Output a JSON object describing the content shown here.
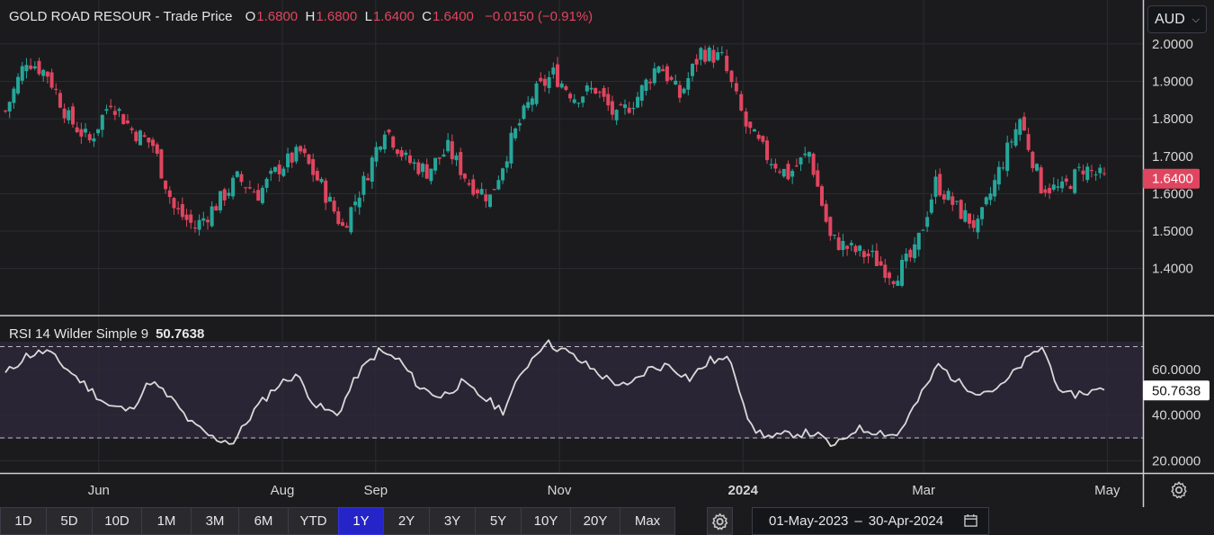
{
  "header": {
    "symbol": "GOLD ROAD RESOUR",
    "separator": "-",
    "price_type": "Trade Price",
    "open_label": "O",
    "open": "1.6800",
    "high_label": "H",
    "high": "1.6800",
    "low_label": "L",
    "low": "1.6400",
    "close_label": "C",
    "close": "1.6400",
    "change": "−0.0150 (−0.91%)"
  },
  "currency_select": {
    "value": "AUD",
    "icon": "chevron-down-icon"
  },
  "rsi_legend": {
    "label": "RSI 14 Wilder Simple 9",
    "value": "50.7638"
  },
  "range_buttons": [
    "1D",
    "5D",
    "10D",
    "1M",
    "3M",
    "6M",
    "YTD",
    "1Y",
    "2Y",
    "3Y",
    "5Y",
    "10Y",
    "20Y",
    "Max"
  ],
  "active_range": "1Y",
  "date_range": {
    "start": "01-May-2023",
    "separator": "–",
    "end": "30-Apr-2024",
    "icon": "calendar-icon"
  },
  "colors": {
    "up": "#26a69a",
    "down": "#e0455f",
    "rsi_line": "#d9d9d9",
    "rsi_band": "#2a2535",
    "active_button": "#2424c8"
  },
  "chart_data": [
    {
      "type": "candlestick",
      "title": "GOLD ROAD RESOUR - Trade Price",
      "ylim": [
        1.32,
        2.05
      ],
      "y_ticks": [
        "2.0000",
        "1.9000",
        "1.8000",
        "1.7000",
        "1.6000",
        "1.5000",
        "1.4000"
      ],
      "x_ticks": [
        "Jun",
        "Aug",
        "Sep",
        "Nov",
        "2024",
        "Mar",
        "May"
      ],
      "last_price_label": "1.6400",
      "grid": true,
      "close_series": [
        {
          "date": "2023-05-01",
          "close": 1.82
        },
        {
          "date": "2023-05-08",
          "close": 1.96
        },
        {
          "date": "2023-05-15",
          "close": 1.92
        },
        {
          "date": "2023-05-22",
          "close": 1.8
        },
        {
          "date": "2023-05-29",
          "close": 1.74
        },
        {
          "date": "2023-06-05",
          "close": 1.85
        },
        {
          "date": "2023-06-12",
          "close": 1.77
        },
        {
          "date": "2023-06-19",
          "close": 1.73
        },
        {
          "date": "2023-06-26",
          "close": 1.56
        },
        {
          "date": "2023-07-03",
          "close": 1.51
        },
        {
          "date": "2023-07-10",
          "close": 1.57
        },
        {
          "date": "2023-07-17",
          "close": 1.64
        },
        {
          "date": "2023-07-24",
          "close": 1.6
        },
        {
          "date": "2023-07-31",
          "close": 1.67
        },
        {
          "date": "2023-08-07",
          "close": 1.71
        },
        {
          "date": "2023-08-14",
          "close": 1.62
        },
        {
          "date": "2023-08-21",
          "close": 1.51
        },
        {
          "date": "2023-08-28",
          "close": 1.63
        },
        {
          "date": "2023-09-04",
          "close": 1.78
        },
        {
          "date": "2023-09-11",
          "close": 1.69
        },
        {
          "date": "2023-09-18",
          "close": 1.66
        },
        {
          "date": "2023-09-25",
          "close": 1.72
        },
        {
          "date": "2023-10-02",
          "close": 1.63
        },
        {
          "date": "2023-10-09",
          "close": 1.59
        },
        {
          "date": "2023-10-16",
          "close": 1.74
        },
        {
          "date": "2023-10-23",
          "close": 1.86
        },
        {
          "date": "2023-10-30",
          "close": 1.92
        },
        {
          "date": "2023-11-06",
          "close": 1.86
        },
        {
          "date": "2023-11-13",
          "close": 1.88
        },
        {
          "date": "2023-11-20",
          "close": 1.8
        },
        {
          "date": "2023-11-27",
          "close": 1.86
        },
        {
          "date": "2023-12-04",
          "close": 1.95
        },
        {
          "date": "2023-12-11",
          "close": 1.86
        },
        {
          "date": "2023-12-18",
          "close": 1.98
        },
        {
          "date": "2023-12-25",
          "close": 1.96
        },
        {
          "date": "2024-01-02",
          "close": 1.78
        },
        {
          "date": "2024-01-09",
          "close": 1.7
        },
        {
          "date": "2024-01-16",
          "close": 1.65
        },
        {
          "date": "2024-01-23",
          "close": 1.71
        },
        {
          "date": "2024-01-30",
          "close": 1.48
        },
        {
          "date": "2024-02-06",
          "close": 1.45
        },
        {
          "date": "2024-02-13",
          "close": 1.43
        },
        {
          "date": "2024-02-20",
          "close": 1.38
        },
        {
          "date": "2024-02-27",
          "close": 1.44
        },
        {
          "date": "2024-03-05",
          "close": 1.63
        },
        {
          "date": "2024-03-12",
          "close": 1.56
        },
        {
          "date": "2024-03-19",
          "close": 1.51
        },
        {
          "date": "2024-03-26",
          "close": 1.66
        },
        {
          "date": "2024-04-02",
          "close": 1.8
        },
        {
          "date": "2024-04-09",
          "close": 1.62
        },
        {
          "date": "2024-04-16",
          "close": 1.61
        },
        {
          "date": "2024-04-23",
          "close": 1.67
        },
        {
          "date": "2024-04-30",
          "close": 1.64
        }
      ]
    },
    {
      "type": "line",
      "title": "RSI 14 Wilder Simple 9",
      "ylim": [
        17,
        82
      ],
      "y_ticks": [
        "60.0000",
        "40.0000",
        "20.0000"
      ],
      "reference_lines": [
        70,
        30
      ],
      "last_value_label": "50.7638",
      "series": [
        {
          "name": "RSI",
          "values": [
            58,
            66,
            68,
            60,
            52,
            44,
            42,
            55,
            47,
            36,
            30,
            28,
            42,
            52,
            58,
            44,
            40,
            58,
            68,
            64,
            52,
            48,
            54,
            48,
            42,
            60,
            72,
            68,
            62,
            56,
            52,
            60,
            62,
            56,
            64,
            64,
            34,
            30,
            32,
            32,
            26,
            34,
            33,
            31,
            46,
            62,
            54,
            50,
            52,
            62,
            70,
            48,
            50,
            51
          ]
        }
      ]
    }
  ]
}
